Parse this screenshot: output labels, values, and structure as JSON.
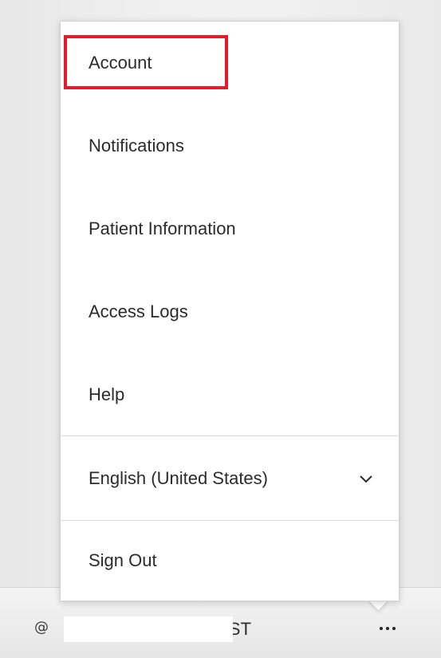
{
  "menu": {
    "items": [
      {
        "label": "Account"
      },
      {
        "label": "Notifications"
      },
      {
        "label": "Patient Information"
      },
      {
        "label": "Access Logs"
      },
      {
        "label": "Help"
      }
    ],
    "language": {
      "selected": "English (United States)"
    },
    "sign_out_label": "Sign Out"
  },
  "bottom_bar": {
    "user_name": "TEST"
  },
  "icons": {
    "at": "at-icon",
    "chevron": "chevron-down-icon",
    "more": "more-horizontal-icon"
  },
  "colors": {
    "highlight": "#e21c2a"
  }
}
